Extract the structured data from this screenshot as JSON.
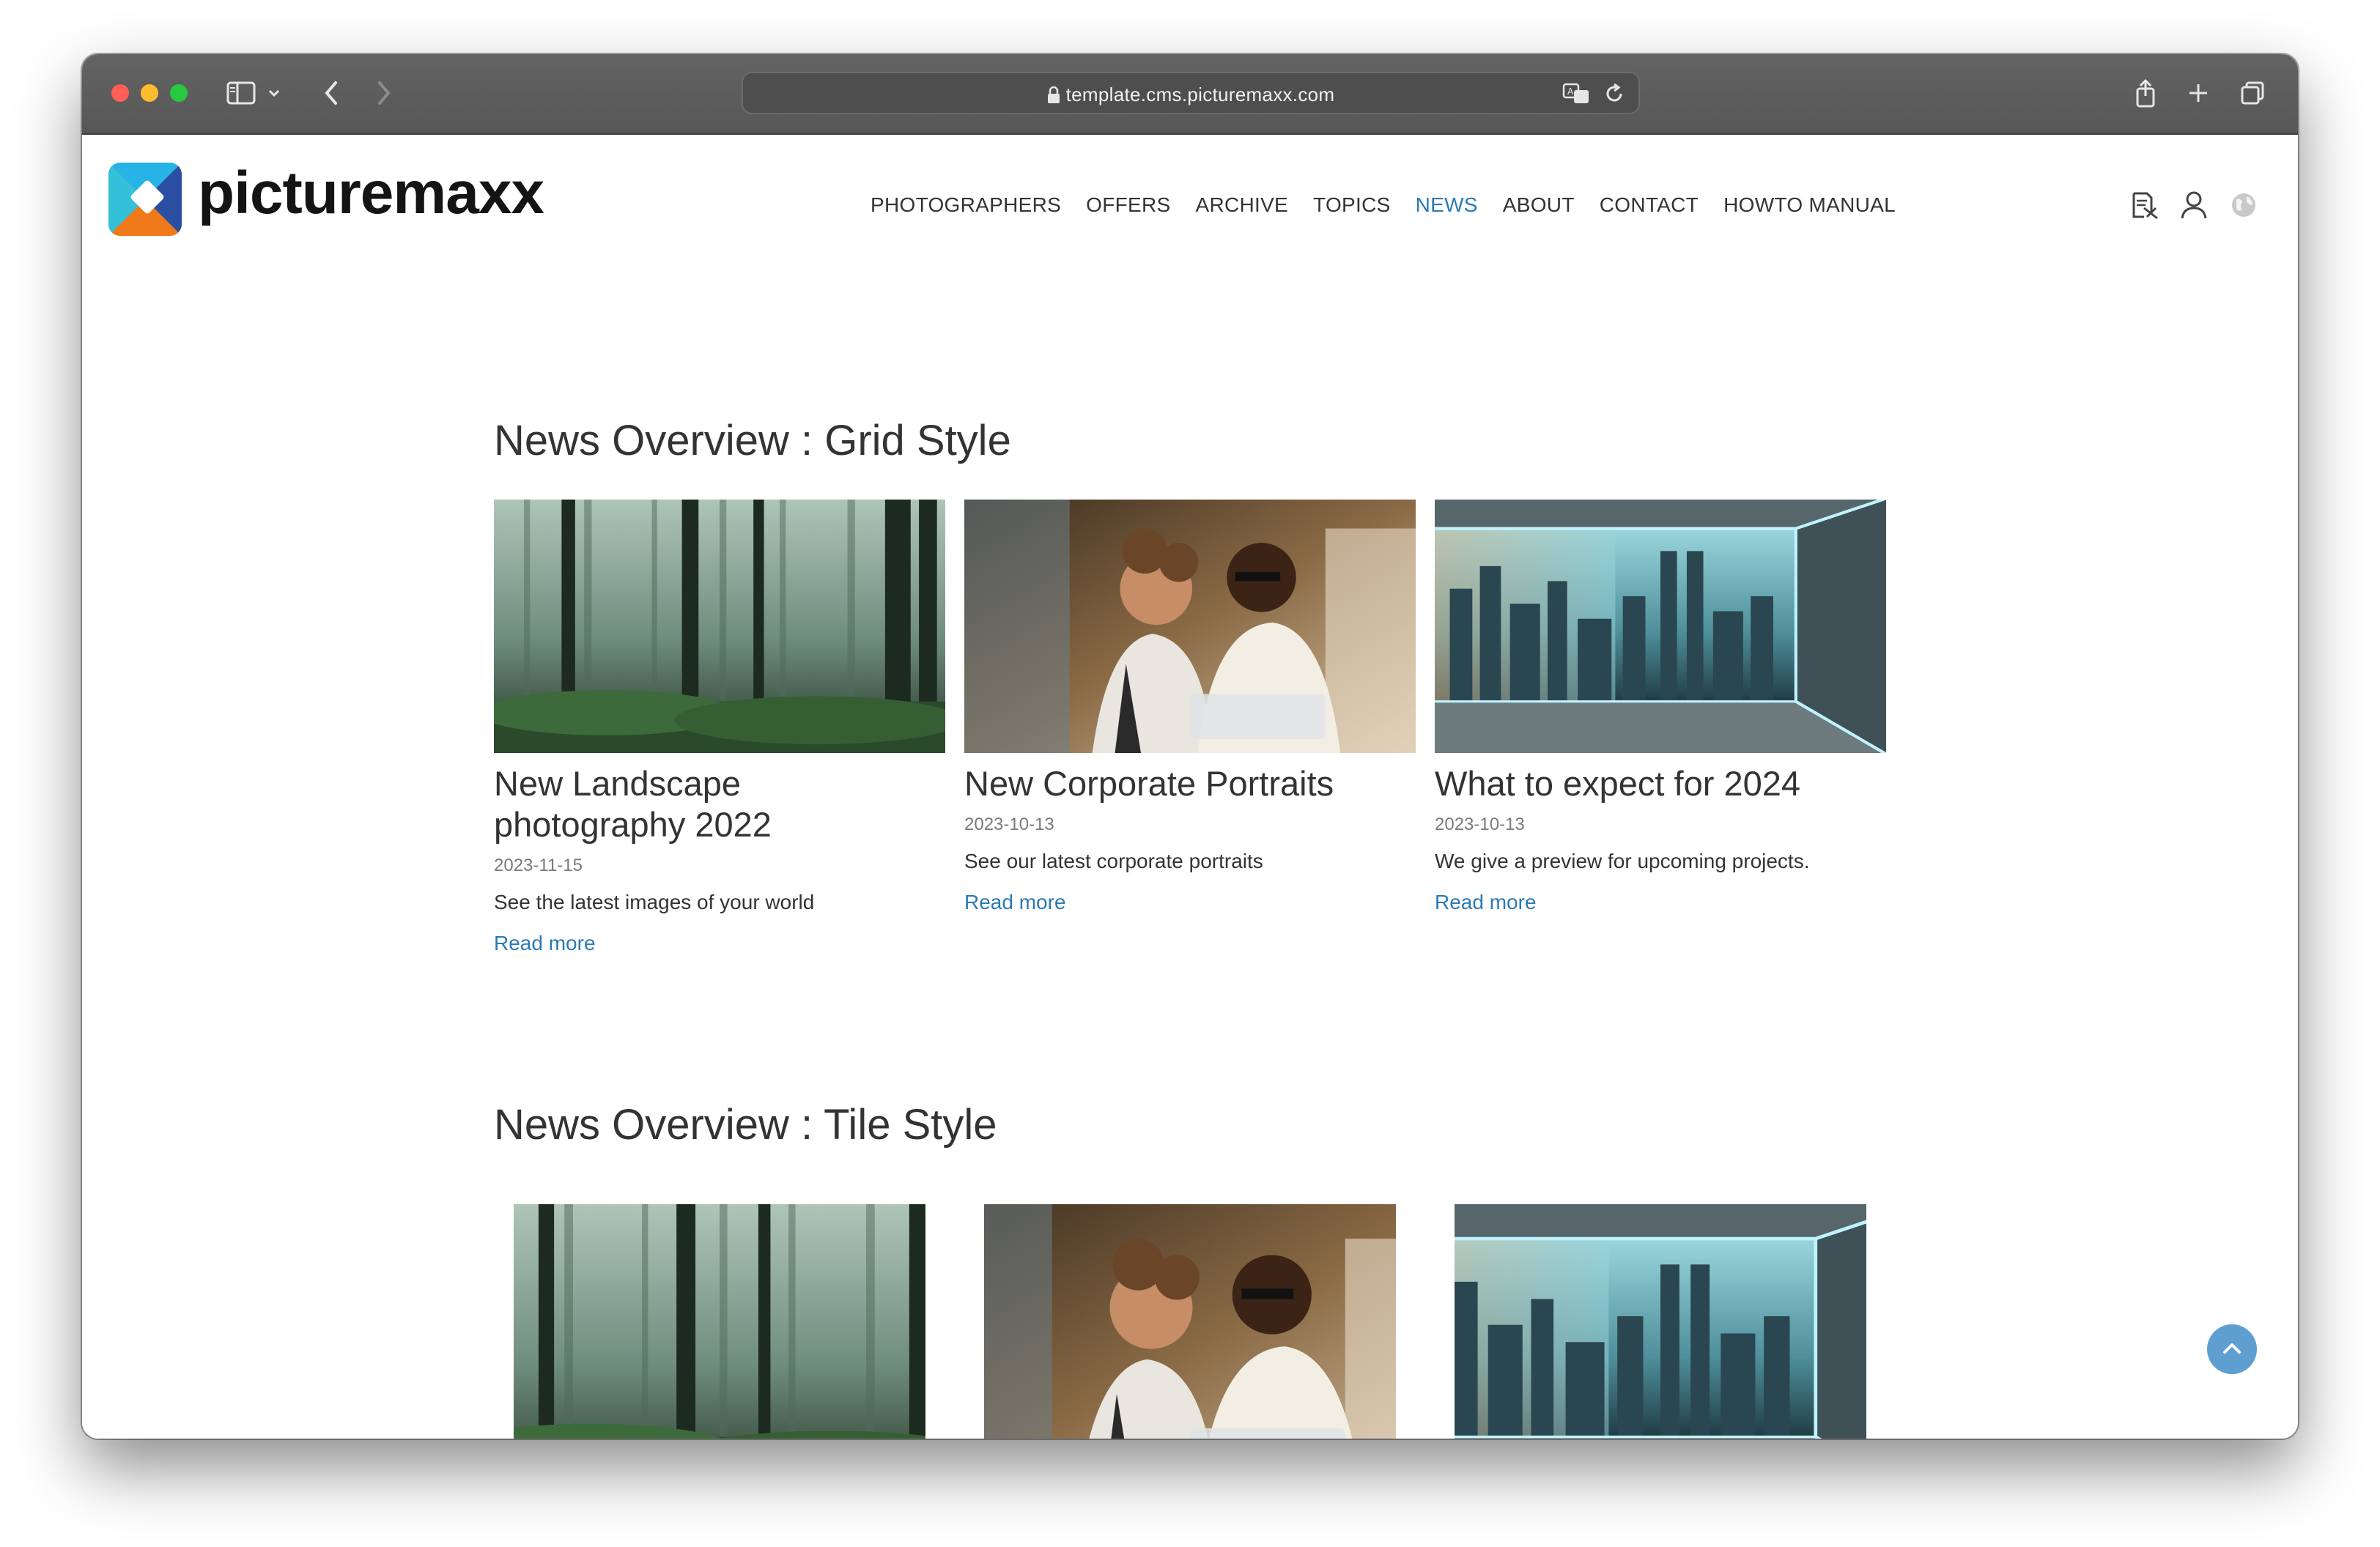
{
  "browser": {
    "url": "template.cms.picturemaxx.com"
  },
  "site": {
    "logo_text": "picturemaxx",
    "nav": [
      {
        "label": "PHOTOGRAPHERS",
        "active": false
      },
      {
        "label": "OFFERS",
        "active": false
      },
      {
        "label": "ARCHIVE",
        "active": false
      },
      {
        "label": "TOPICS",
        "active": false
      },
      {
        "label": "NEWS",
        "active": true
      },
      {
        "label": "ABOUT",
        "active": false
      },
      {
        "label": "CONTACT",
        "active": false
      },
      {
        "label": "HOWTO MANUAL",
        "active": false
      }
    ],
    "header_icons": [
      "lightbox-icon",
      "user-icon",
      "globe-icon"
    ]
  },
  "grid_section": {
    "title": "News Overview : Grid Style",
    "cards": [
      {
        "image": "foggy-forest-image",
        "title_lines": [
          "New Landscape",
          "photography 2022"
        ],
        "date": "2023-11-15",
        "description": "See the latest images of your world",
        "link": "Read more"
      },
      {
        "image": "corporate-portrait-image",
        "title_lines": [
          "New Corporate Portraits"
        ],
        "date": "2023-10-13",
        "description": "See our latest corporate portraits",
        "link": "Read more"
      },
      {
        "image": "city-skyline-image",
        "title_lines": [
          "What to expect for 2024"
        ],
        "date": "2023-10-13",
        "description": "We give a preview for upcoming projects.",
        "link": "Read more"
      }
    ]
  },
  "tile_section": {
    "title": "News Overview : Tile Style",
    "tiles": [
      "foggy-forest-image",
      "corporate-portrait-image",
      "city-skyline-image"
    ]
  },
  "colors": {
    "accent": "#2a7ab4",
    "text": "#333333",
    "muted": "#7a7a7a",
    "back_to_top": "#5f9fd0"
  }
}
